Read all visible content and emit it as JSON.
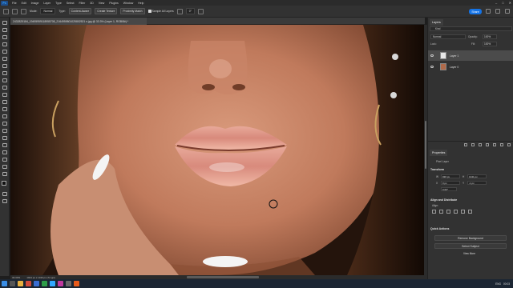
{
  "menubar": {
    "logo": "Ps",
    "items": [
      "File",
      "Edit",
      "Image",
      "Layer",
      "Type",
      "Select",
      "Filter",
      "3D",
      "View",
      "Plugins",
      "Window",
      "Help"
    ]
  },
  "options": {
    "mode_label": "Mode:",
    "mode_value": "Normal",
    "type_label": "Type:",
    "type_buttons": [
      "Content-Aware",
      "Create Texture",
      "Proximity Match"
    ],
    "sample_all_layers": "Sample All Layers",
    "angle_value": "0°",
    "share_label": "Share"
  },
  "document": {
    "tab_title": "2432825184_19495959118955708_2164959801025802521 n.jpg @ 33.3% (Layer 1, RGB/8#) *"
  },
  "status": {
    "zoom": "33.33%",
    "doc_size": "1024 px x 1340 px (72 ppi)"
  },
  "layers_panel": {
    "tab_label": "Layers",
    "kind_label": "Kind",
    "blend_mode": "Normal",
    "opacity_label": "Opacity:",
    "opacity_value": "100%",
    "lock_label": "Lock:",
    "fill_label": "Fill:",
    "fill_value": "100%",
    "layers": [
      {
        "name": "Layer 1",
        "selected": true
      },
      {
        "name": "Layer 0",
        "selected": false
      }
    ]
  },
  "properties_panel": {
    "tab_label": "Properties",
    "layer_type": "Pixel Layer",
    "transform_label": "Transform",
    "w_label": "W",
    "w_value": "936 px",
    "h_label": "H",
    "h_value": "1341 px",
    "x_label": "X",
    "x_value": "0 px",
    "y_label": "Y",
    "y_value": "-1 px",
    "angle_value": "0.00°",
    "align_label": "Align and Distribute",
    "align_sub": "Align:",
    "quick_actions_label": "Quick Actions",
    "remove_bg": "Remove Background",
    "select_subject": "Select Subject",
    "view_more": "View More"
  },
  "taskbar": {
    "lang": "ENG",
    "time": "00:03"
  },
  "colors": {
    "accent": "#1473e6",
    "panel_bg": "#323232",
    "app_bg": "#1e1e1e"
  }
}
